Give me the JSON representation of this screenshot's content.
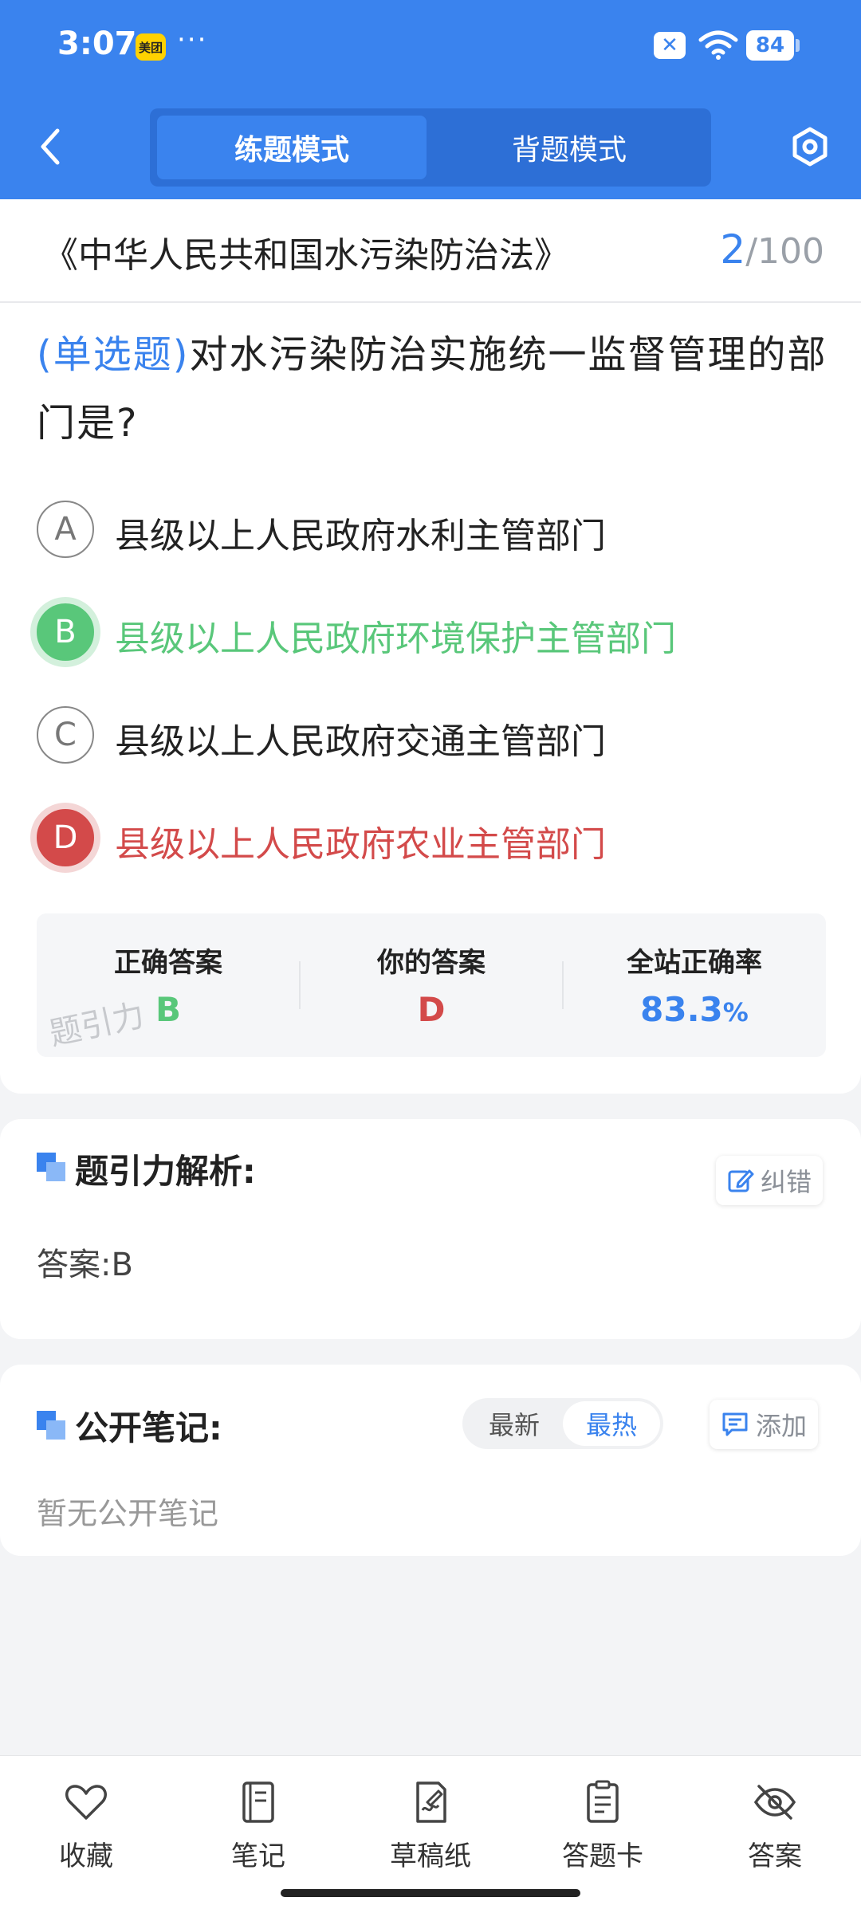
{
  "status_bar": {
    "time": "3:07",
    "app_badge": "美团",
    "dots": "···",
    "battery": "84"
  },
  "header": {
    "tab_practice": "练题模式",
    "tab_memorize": "背题模式"
  },
  "title_row": {
    "law_title": "《中华人民共和国水污染防治法》",
    "current": "2",
    "total": "/100"
  },
  "question": {
    "type_label": "(单选题)",
    "text": "对水污染防治实施统一监督管理的部门是?",
    "options": [
      {
        "letter": "A",
        "text": "县级以上人民政府水利主管部门",
        "state": "normal"
      },
      {
        "letter": "B",
        "text": "县级以上人民政府环境保护主管部门",
        "state": "correct"
      },
      {
        "letter": "C",
        "text": "县级以上人民政府交通主管部门",
        "state": "normal"
      },
      {
        "letter": "D",
        "text": "县级以上人民政府农业主管部门",
        "state": "wrong"
      }
    ]
  },
  "result": {
    "correct_label": "正确答案",
    "correct_value": "B",
    "your_label": "你的答案",
    "your_value": "D",
    "rate_label": "全站正确率",
    "rate_value": "83.3",
    "rate_unit": "%",
    "watermark": "题引力"
  },
  "analysis": {
    "title": "题引力解析:",
    "report_label": "纠错",
    "answer": "答案:B"
  },
  "notes": {
    "title": "公开笔记:",
    "sort_newest": "最新",
    "sort_hottest": "最热",
    "sort_selected": "最热",
    "add_label": "添加",
    "empty": "暂无公开笔记"
  },
  "bottom_nav": [
    {
      "icon": "heart-icon",
      "label": "收藏"
    },
    {
      "icon": "notebook-icon",
      "label": "笔记"
    },
    {
      "icon": "draft-paper-icon",
      "label": "草稿纸"
    },
    {
      "icon": "answer-card-icon",
      "label": "答题卡"
    },
    {
      "icon": "eye-off-icon",
      "label": "答案"
    }
  ],
  "colors": {
    "primary": "#3a83ee",
    "correct": "#59c77a",
    "wrong": "#d34a4a"
  }
}
